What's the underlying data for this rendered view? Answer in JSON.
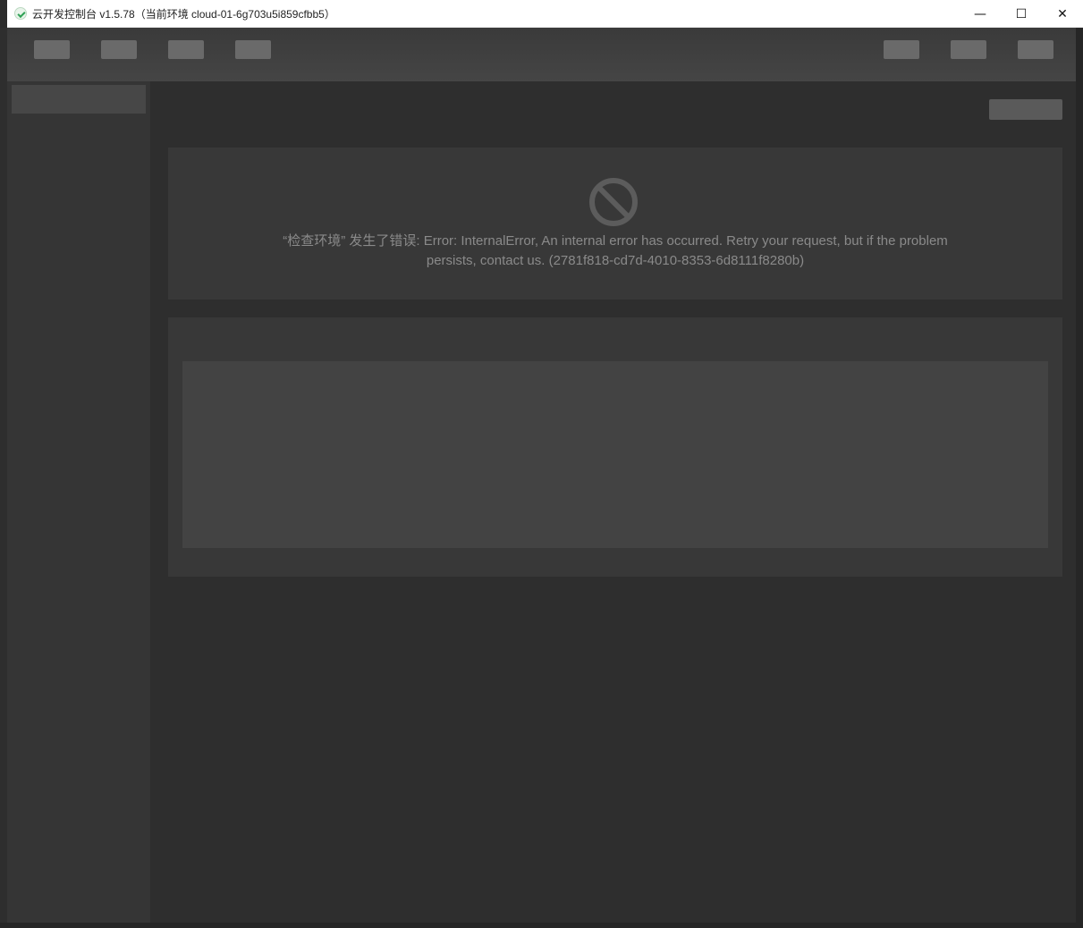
{
  "window": {
    "title": "云开发控制台 v1.5.78（当前环境 cloud-01-6g703u5i859cfbb5）",
    "controls": {
      "minimize": "—",
      "maximize": "☐",
      "close": "✕"
    }
  },
  "error": {
    "message": "“检查环境” 发生了错误: Error: InternalError, An internal error has occurred. Retry your request, but if the problem persists, contact us. (2781f818-cd7d-4010-8353-6d8111f8280b)",
    "icon": "prohibited-icon"
  },
  "colors": {
    "background": "#2e2e2e",
    "panel": "#383838",
    "error_text": "#8a8a8a",
    "icon": "#5c5c5c"
  }
}
